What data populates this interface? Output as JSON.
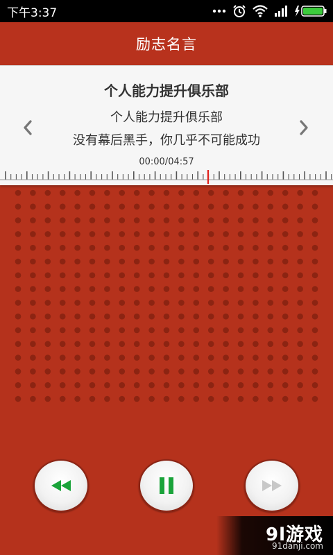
{
  "status_bar": {
    "time": "下午3:37",
    "icons": [
      "more-icon",
      "alarm-icon",
      "wifi-icon",
      "signal-icon",
      "battery-charging-icon"
    ]
  },
  "app": {
    "title": "励志名言"
  },
  "player": {
    "track_title": "个人能力提升俱乐部",
    "lyric_line_1": "个人能力提升俱乐部",
    "lyric_line_2": "没有幕后黑手，你几乎不可能成功",
    "time_display": "00:00/04:57",
    "prev_icon": "chevron-left-icon",
    "next_icon": "chevron-right-icon",
    "controls": {
      "rewind_icon": "rewind-icon",
      "pause_icon": "pause-icon",
      "fast_forward_icon": "fast-forward-icon"
    }
  },
  "colors": {
    "background": "#b5321c",
    "accent_green": "#1aa33a",
    "marker_red": "#e0201a",
    "disabled_gray": "#c8c8c8"
  },
  "watermark": {
    "logo": "9l游戏",
    "url": "91danji.com"
  }
}
